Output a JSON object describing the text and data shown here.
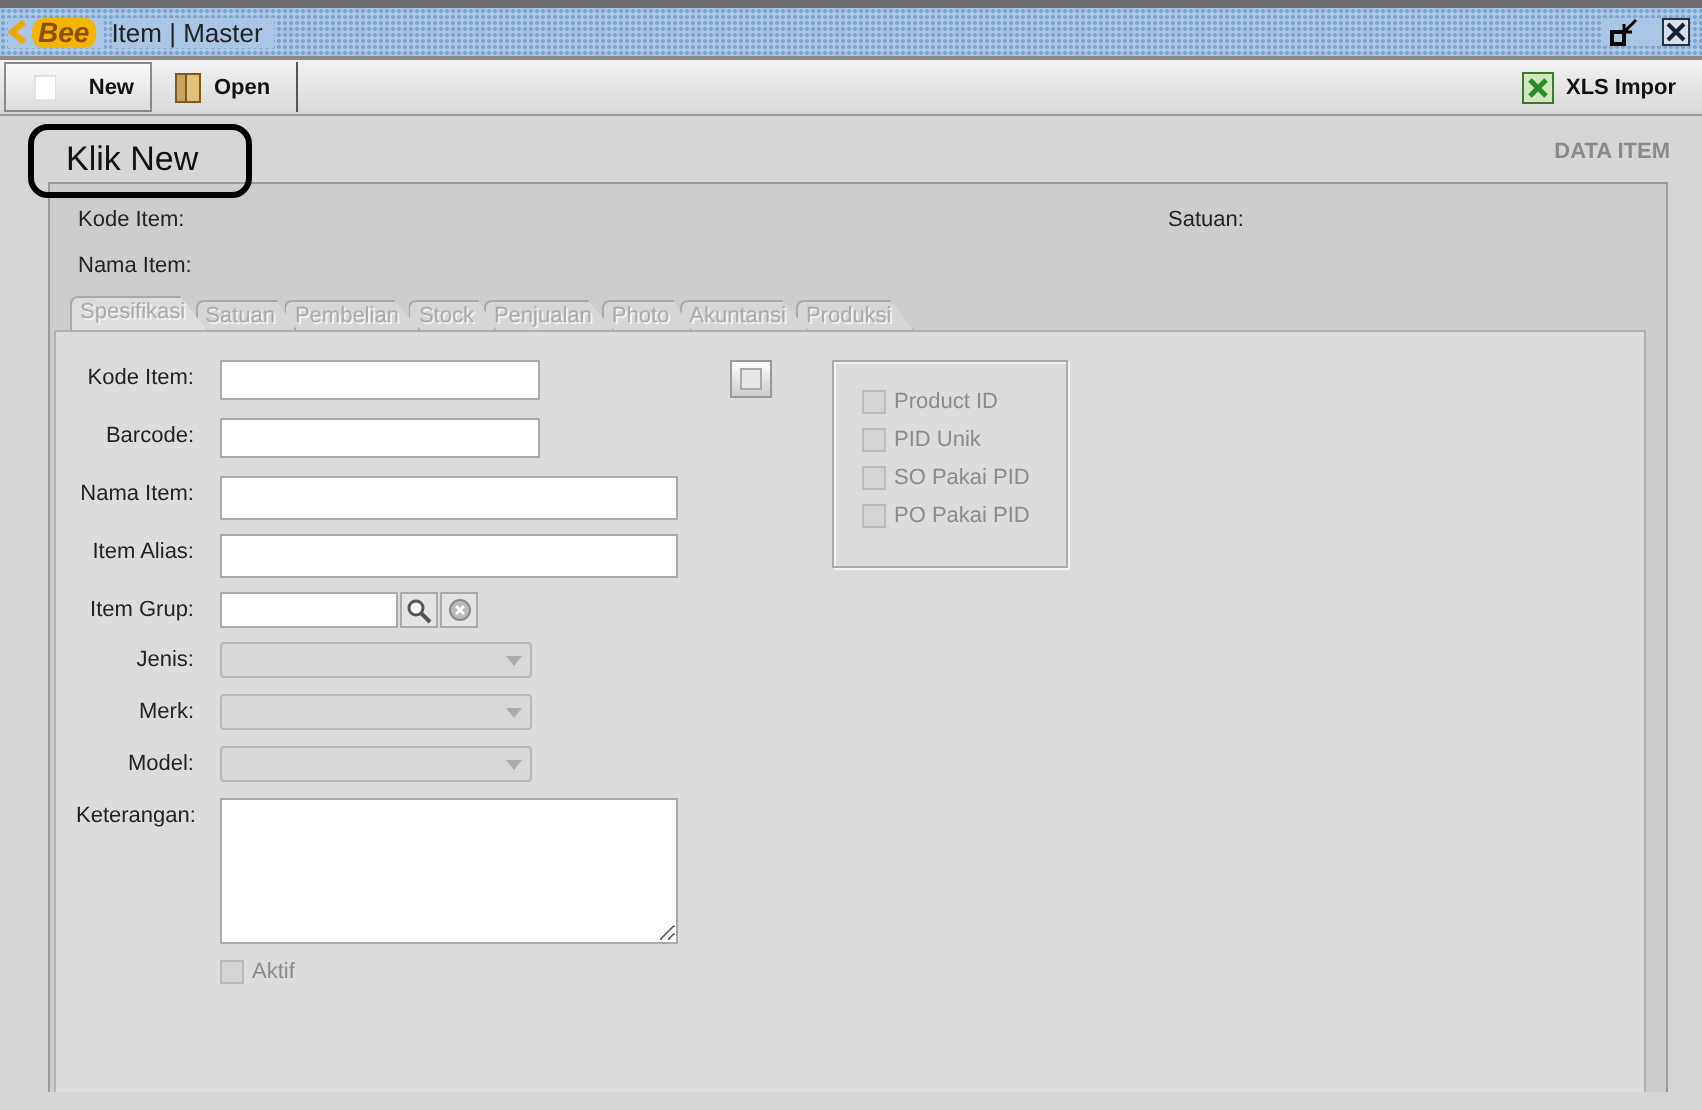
{
  "window": {
    "logo": "Bee",
    "title": "Item | Master"
  },
  "toolbar": {
    "left": [
      {
        "label": "New",
        "kind": "blank"
      },
      {
        "label": "Open",
        "kind": "door"
      }
    ],
    "right": [
      {
        "label": "XLS Impor",
        "kind": "excel"
      }
    ]
  },
  "annotation": "Klik New",
  "header": "DATA ITEM",
  "summary": {
    "left": [
      "Kode Item:",
      "Nama Item:"
    ],
    "right": [
      "Satuan:"
    ]
  },
  "tabs": [
    {
      "label": "Spesifikasi",
      "selected": true
    },
    {
      "label": "Satuan",
      "selected": false
    },
    {
      "label": "Pembelian",
      "selected": false
    },
    {
      "label": "Stock",
      "selected": false
    },
    {
      "label": "Penjualan",
      "selected": false
    },
    {
      "label": "Photo",
      "selected": false
    },
    {
      "label": "Akuntansi",
      "selected": false
    },
    {
      "label": "Produksi",
      "selected": false
    }
  ],
  "form": [
    {
      "label": "Kode Item:",
      "kind": "short_text",
      "disabled": false
    },
    {
      "label": "Barcode:",
      "kind": "short_text",
      "disabled": false
    },
    {
      "label": "Nama Item:",
      "kind": "long_text",
      "disabled": false
    },
    {
      "label": "Item Alias:",
      "kind": "long_text",
      "disabled": false
    },
    {
      "label": "Item Grup:",
      "kind": "lookup",
      "disabled": false
    },
    {
      "label": "Jenis:",
      "kind": "combo",
      "disabled": true
    },
    {
      "label": "Merk:",
      "kind": "combo",
      "disabled": true
    },
    {
      "label": "Model:",
      "kind": "combo",
      "disabled": true
    },
    {
      "label": "Keterangan:",
      "kind": "textarea",
      "disabled": false
    }
  ],
  "aktif": {
    "label": "Aktif",
    "checked": false,
    "disabled": true
  },
  "options": [
    {
      "label": "Product ID",
      "checked": false,
      "disabled": true
    },
    {
      "label": "PID Unik",
      "checked": false,
      "disabled": true
    },
    {
      "label": "SO Pakai PID",
      "checked": false,
      "disabled": true
    },
    {
      "label": "PO Pakai PID",
      "checked": false,
      "disabled": true
    }
  ]
}
